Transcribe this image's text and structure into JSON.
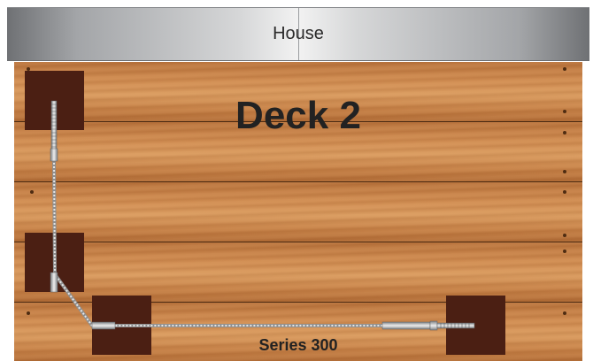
{
  "house": {
    "label": "House"
  },
  "deck": {
    "title": "Deck 2"
  },
  "product": {
    "series_label": "Series 300"
  },
  "colors": {
    "post": "#4b1f13",
    "wood": "#cf8a4f",
    "house_light": "#f2f2f2",
    "house_dark": "#6f7174",
    "cable": "#c8c8c8"
  },
  "icons": [
    "cable-run",
    "threaded-terminal-icon",
    "swage-fitting-icon"
  ]
}
